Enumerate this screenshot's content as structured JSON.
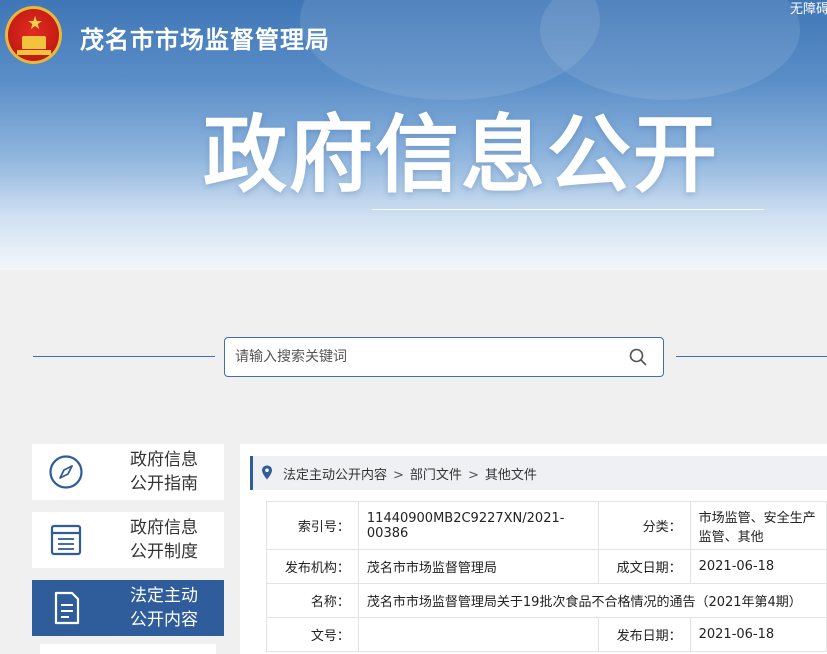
{
  "header": {
    "site_title": "茂名市市场监督管理局",
    "accessibility_link": "无障碍",
    "hero_title": "政府信息公开"
  },
  "search": {
    "placeholder": "请输入搜索关键词"
  },
  "sidebar": {
    "items": [
      {
        "label": "政府信息公开指南",
        "icon": "compass-icon"
      },
      {
        "label": "政府信息公开制度",
        "icon": "list-doc-icon"
      },
      {
        "label": "法定主动公开内容",
        "icon": "document-icon",
        "active": true
      }
    ]
  },
  "breadcrumb": {
    "items": [
      "法定主动公开内容",
      "部门文件",
      "其他文件"
    ]
  },
  "meta": {
    "index_label": "索引号：",
    "index_value": "11440900MB2C9227XN/2021-00386",
    "category_label": "分类：",
    "category_value": "市场监管、安全生产监管、其他",
    "publisher_label": "发布机构：",
    "publisher_value": "茂名市市场监督管理局",
    "created_label": "成文日期：",
    "created_value": "2021-06-18",
    "name_label": "名称：",
    "name_value": "茂名市市场监督管理局关于19批次食品不合格情况的通告（2021年第4期）",
    "docno_label": "文号：",
    "docno_value": "",
    "published_label": "发布日期：",
    "published_value": "2021-06-18"
  },
  "colors": {
    "brand_blue": "#2f5c9b",
    "banner_top": "#3f76b6"
  }
}
